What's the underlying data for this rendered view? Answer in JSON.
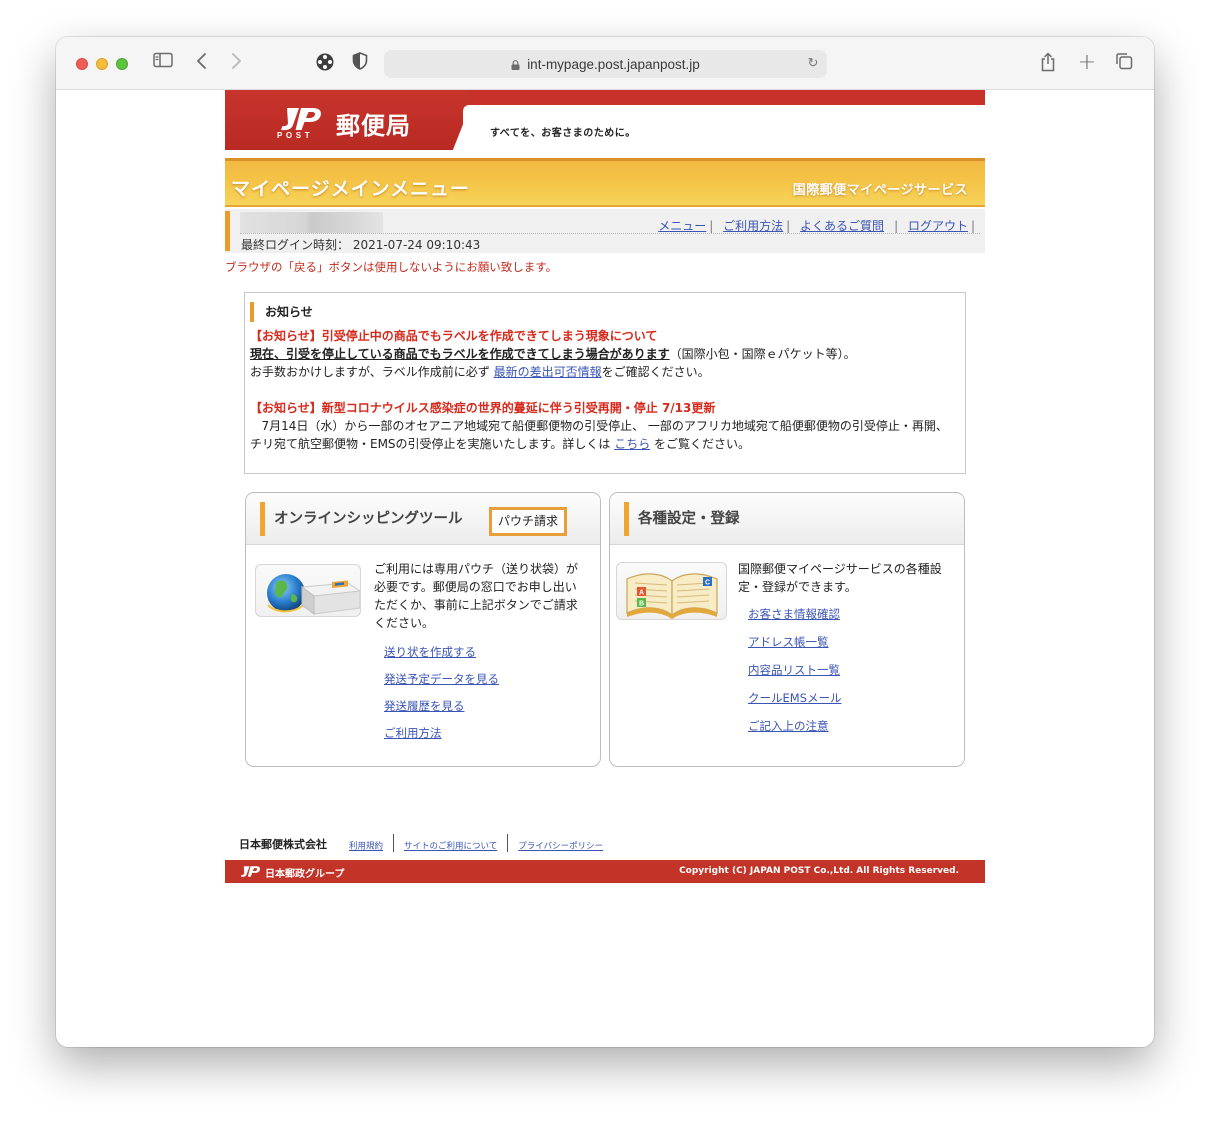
{
  "browser": {
    "url": "int-mypage.post.japanpost.jp"
  },
  "header": {
    "post_mark": "POST",
    "brand": "郵便局",
    "tagline": "すべてを、お客さまのために。"
  },
  "title_bar": {
    "title": "マイページメインメニュー",
    "service": "国際郵便マイページサービス"
  },
  "user_bar": {
    "login_time": "最終ログイン時刻： 2021-07-24 09:10:43",
    "links": [
      "メニュー",
      "ご利用方法",
      "よくあるご質問",
      "ログアウト"
    ]
  },
  "warning": "ブラウザの「戻る」ボタンは使用しないようにお願い致します。",
  "notice": {
    "heading": "お知らせ",
    "item1_title": "【お知らせ】引受停止中の商品でもラベルを作成できてしまう現象について",
    "item1_line1_bold": "現在、引受を停止している商品でもラベルを作成できてしまう場合があります",
    "item1_line1_rest": "（国際小包・国際ｅパケット等）。",
    "item1_line2_pre": "お手数おかけしますが、ラベル作成前に必ず",
    "item1_line2_link": "最新の差出可否情報",
    "item1_line2_post": "をご確認ください。",
    "item2_title": "【お知らせ】新型コロナウイルス感染症の世界的蔓延に伴う引受再開・停止 7/13更新",
    "item2_line1": "7月14日（水）から一部のオセアニア地域宛て船便郵便物の引受停止、 一部のアフリカ地域宛て船便郵便物の引受停止・再開、",
    "item2_line2_pre": "チリ宛て航空郵便物・EMSの引受停止を実施いたします。詳しくは",
    "item2_line2_link": "こちら",
    "item2_line2_post": "をご覧ください。"
  },
  "shipping": {
    "title": "オンラインシッピングツール",
    "pouch_button": "パウチ請求",
    "description": "ご利用には専用パウチ（送り状袋）が必要です。郵便局の窓口でお申し出いただくか、事前に上記ボタンでご請求ください。",
    "links": [
      "送り状を作成する",
      "発送予定データを見る",
      "発送履歴を見る",
      "ご利用方法"
    ]
  },
  "settings": {
    "title": "各種設定・登録",
    "description": "国際郵便マイページサービスの各種設定・登録ができます。",
    "links": [
      "お客さま情報確認",
      "アドレス帳一覧",
      "内容品リスト一覧",
      "クールEMSメール",
      "ご記入上の注意"
    ]
  },
  "footer": {
    "company": "日本郵便株式会社",
    "links": [
      "利用規約",
      "サイトのご利用について",
      "プライバシーポリシー"
    ],
    "group": "日本郵政グループ",
    "copyright": "Copyright (C) JAPAN POST Co.,Ltd.  All Rights Reserved."
  },
  "colors": {
    "brand_red": "#c8312a",
    "title_orange": "#f4c346",
    "accent_orange": "#ed9a2a",
    "link_blue": "#3b55b5",
    "warning_red": "#c22b1e"
  },
  "icons": {
    "sidebar": "sidebar-icon",
    "back": "chevron-left-icon",
    "forward": "chevron-right-icon",
    "lock": "lock-icon",
    "reload": "reload-icon",
    "share": "share-icon",
    "new_tab": "plus-icon",
    "tabs": "tabs-overview-icon"
  }
}
